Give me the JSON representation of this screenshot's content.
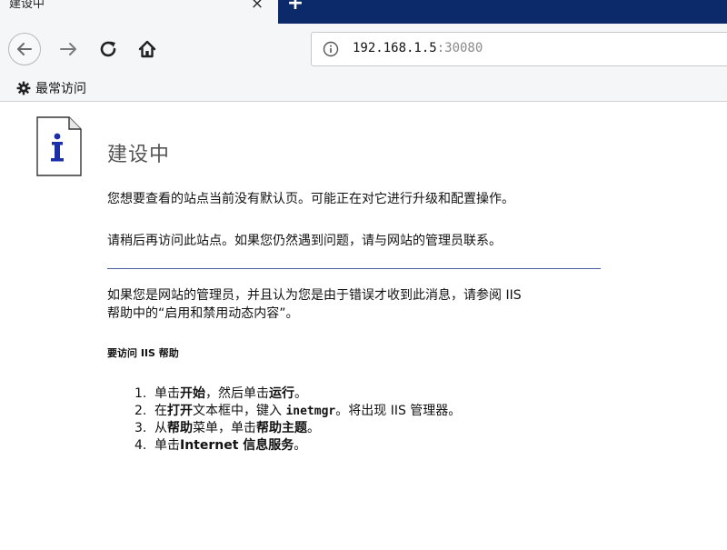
{
  "browser": {
    "tab": {
      "title": "建设中",
      "close_symbol": "×"
    },
    "new_tab_symbol": "+",
    "url": {
      "host": "192.168.1.5",
      "port": ":30080"
    },
    "bookmarks": [
      {
        "label": "最常访问",
        "icon": "gear-icon"
      }
    ],
    "colors": {
      "tabbar": "#0c2a6a",
      "toolbar": "#f5f6f7"
    }
  },
  "page": {
    "heading": "建设中",
    "paragraphs": [
      "您想要查看的站点当前没有默认页。可能正在对它进行升级和配置操作。",
      "请稍后再访问此站点。如果您仍然遇到问题，请与网站的管理员联系。"
    ],
    "admin_note": [
      "如果您是网站的管理员，并且认为您是由于错误才收到此消息，请参阅 IIS",
      "帮助中的“启用和禁用动态内容”。"
    ],
    "subheading": "要访问 IIS 帮助",
    "steps": [
      {
        "num": "1.",
        "a": "单击",
        "b": "开始",
        "c": "，然后单击",
        "d": "运行",
        "e": "。"
      },
      {
        "num": "2.",
        "a": "在",
        "b": "打开",
        "c": "文本框中，键入 ",
        "d": "inetmgr",
        "e": "。将出现 IIS 管理器。"
      },
      {
        "num": "3.",
        "a": "从",
        "b": "帮助",
        "c": "菜单，单击",
        "d": "帮助主题",
        "e": "。"
      },
      {
        "num": "4.",
        "a": "单击",
        "b": "Internet 信息服务",
        "c": "",
        "d": "",
        "e": "。"
      }
    ],
    "colors": {
      "divider": "#4a5c9e",
      "icon_letter": "#1a2fa8"
    }
  }
}
